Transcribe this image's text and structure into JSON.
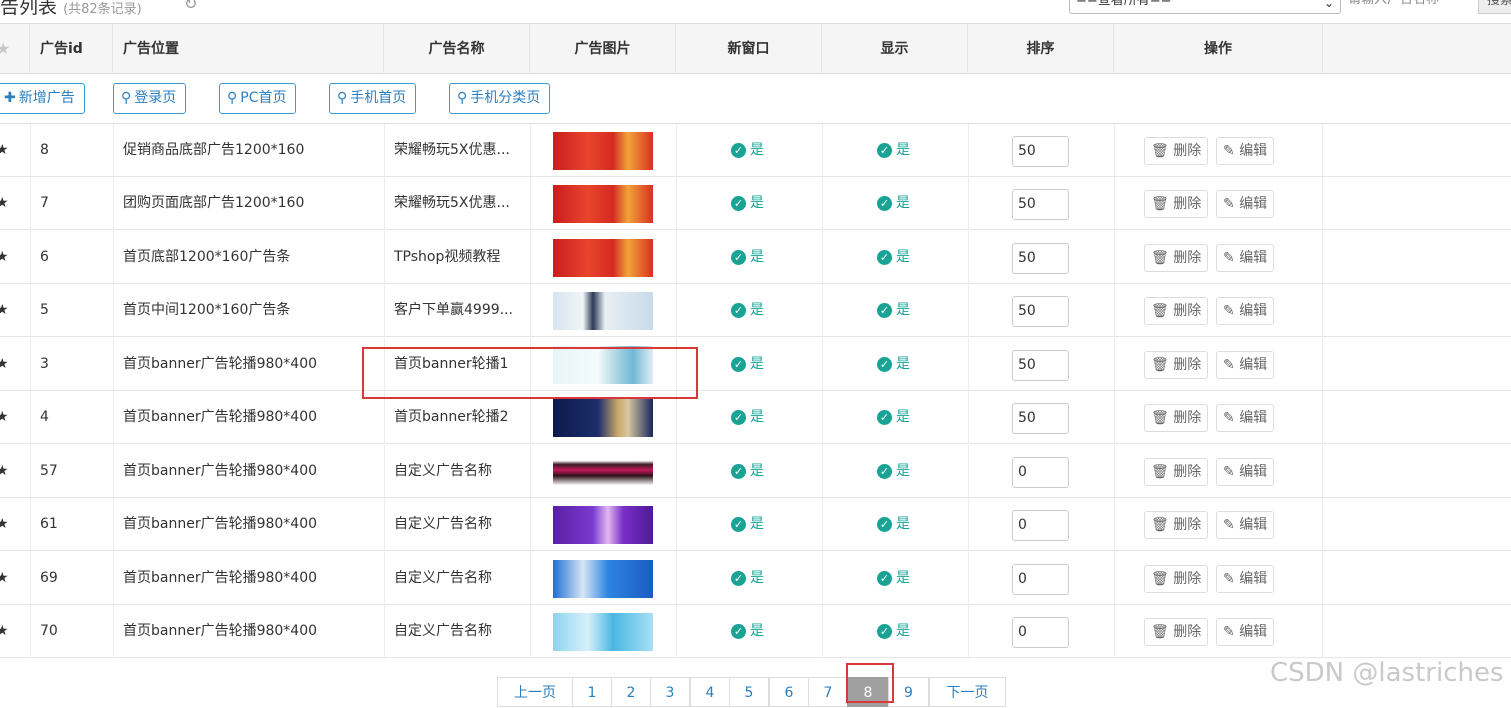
{
  "page": {
    "title": "告列表",
    "subtitle": "(共82条记录)",
    "filter_select": "==查看所有==",
    "search_placeholder": "请输入广告名称",
    "search_button": "搜索"
  },
  "table": {
    "columns": [
      "广告id",
      "广告位置",
      "广告名称",
      "广告图片",
      "新窗口",
      "显示",
      "排序",
      "操作"
    ]
  },
  "toolbar": {
    "add": "新增广告",
    "filters": [
      "登录页",
      "PC首页",
      "手机首页",
      "手机分类页"
    ]
  },
  "yes_label": "是",
  "delete_label": "删除",
  "edit_label": "编辑",
  "rows": [
    {
      "id": "8",
      "position": "促销商品底部广告1200*160",
      "name": "荣耀畅玩5X优惠...",
      "thumb": "red",
      "sort": "50"
    },
    {
      "id": "7",
      "position": "团购页面底部广告1200*160",
      "name": "荣耀畅玩5X优惠...",
      "thumb": "red",
      "sort": "50"
    },
    {
      "id": "6",
      "position": "首页底部1200*160广告条",
      "name": "TPshop视频教程",
      "thumb": "red",
      "sort": "50"
    },
    {
      "id": "5",
      "position": "首页中间1200*160广告条",
      "name": "客户下单赢4999...",
      "thumb": "lightblue",
      "sort": "50"
    },
    {
      "id": "3",
      "position": "首页banner广告轮播980*400",
      "name": "首页banner轮播1",
      "thumb": "kid",
      "sort": "50"
    },
    {
      "id": "4",
      "position": "首页banner广告轮播980*400",
      "name": "首页banner轮播2",
      "thumb": "navy",
      "sort": "50"
    },
    {
      "id": "57",
      "position": "首页banner广告轮播980*400",
      "name": "自定义广告名称",
      "thumb": "dark",
      "sort": "0"
    },
    {
      "id": "61",
      "position": "首页banner广告轮播980*400",
      "name": "自定义广告名称",
      "thumb": "purple",
      "sort": "0"
    },
    {
      "id": "69",
      "position": "首页banner广告轮播980*400",
      "name": "自定义广告名称",
      "thumb": "blue",
      "sort": "0"
    },
    {
      "id": "70",
      "position": "首页banner广告轮播980*400",
      "name": "自定义广告名称",
      "thumb": "cyan",
      "sort": "0"
    }
  ],
  "pagination": {
    "prev": "上一页",
    "pages": [
      "1",
      "2",
      "3",
      "4",
      "5",
      "6",
      "7",
      "8",
      "9"
    ],
    "current": "8",
    "next": "下一页"
  },
  "watermark": "CSDN @lastriches",
  "colors": {
    "accent": "#2a7fc0",
    "ok": "#1aa394",
    "highlight": "#d9383a"
  }
}
